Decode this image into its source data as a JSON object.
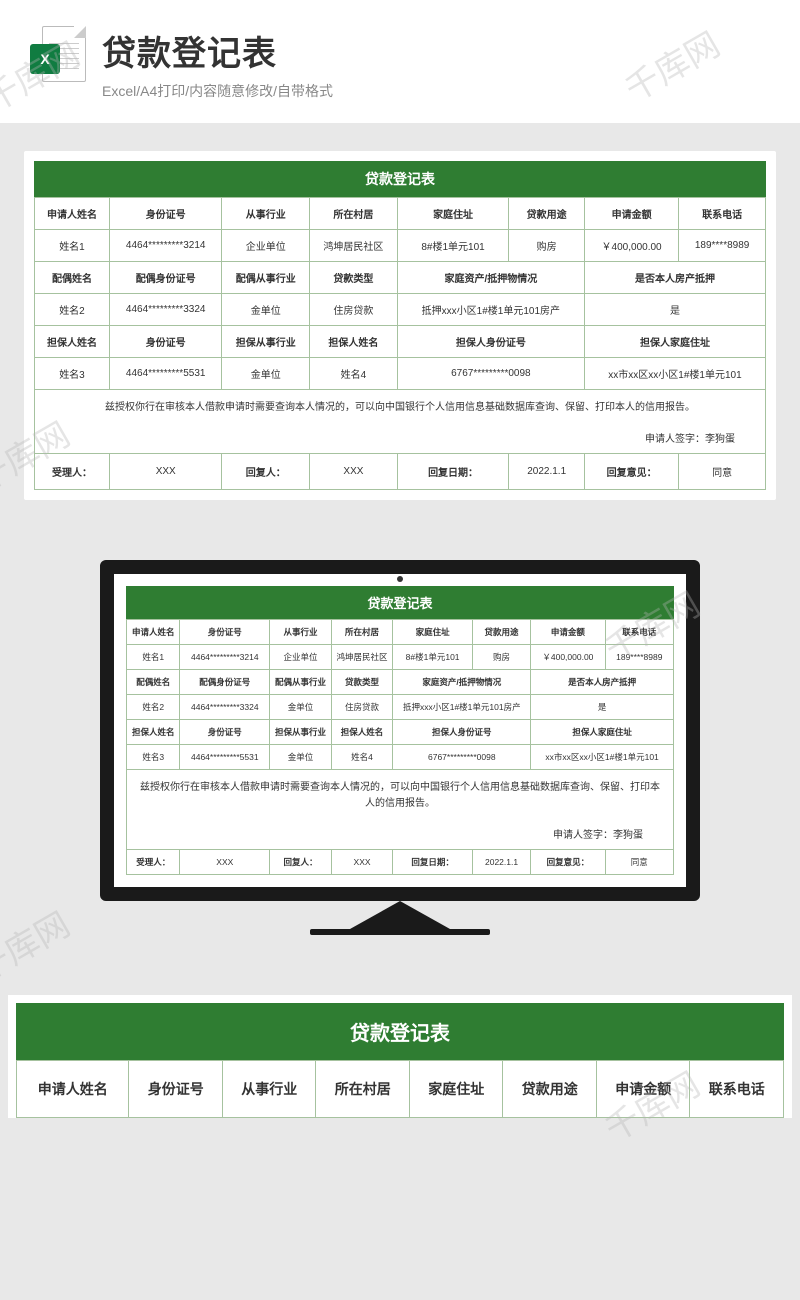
{
  "watermark": "千库网",
  "header": {
    "title": "贷款登记表",
    "subtitle": "Excel/A4打印/内容随意修改/自带格式",
    "iconLetter": "X"
  },
  "form": {
    "title": "贷款登记表",
    "row1_h": [
      "申请人姓名",
      "身份证号",
      "从事行业",
      "所在村居",
      "家庭住址",
      "贷款用途",
      "申请金额",
      "联系电话"
    ],
    "row1_d": [
      "姓名1",
      "4464*********3214",
      "企业单位",
      "鸿坤居民社区",
      "8#楼1单元101",
      "购房",
      "￥400,000.00",
      "189****8989"
    ],
    "row2_h": [
      "配偶姓名",
      "配偶身份证号",
      "配偶从事行业",
      "贷款类型",
      "家庭资产/抵押物情况",
      "是否本人房产抵押"
    ],
    "row2_d": [
      "姓名2",
      "4464*********3324",
      "金单位",
      "住房贷款",
      "抵押xxx小区1#楼1单元101房产",
      "是"
    ],
    "row3_h": [
      "担保人姓名",
      "身份证号",
      "担保从事行业",
      "担保人姓名",
      "担保人身份证号",
      "担保人家庭住址"
    ],
    "row3_d": [
      "姓名3",
      "4464*********5531",
      "金单位",
      "姓名4",
      "6767*********0098",
      "xx市xx区xx小区1#楼1单元101"
    ],
    "auth": "兹授权你行在审核本人借款申请时需要查询本人情况的，可以向中国银行个人信用信息基础数据库查询、保留、打印本人的信用报告。",
    "sign": "申请人签字：李狗蛋",
    "footer_h": [
      "受理人：",
      "回复人：",
      "回复日期：",
      "回复意见："
    ],
    "footer_d": [
      "XXX",
      "XXX",
      "2022.1.1",
      "同意"
    ]
  }
}
